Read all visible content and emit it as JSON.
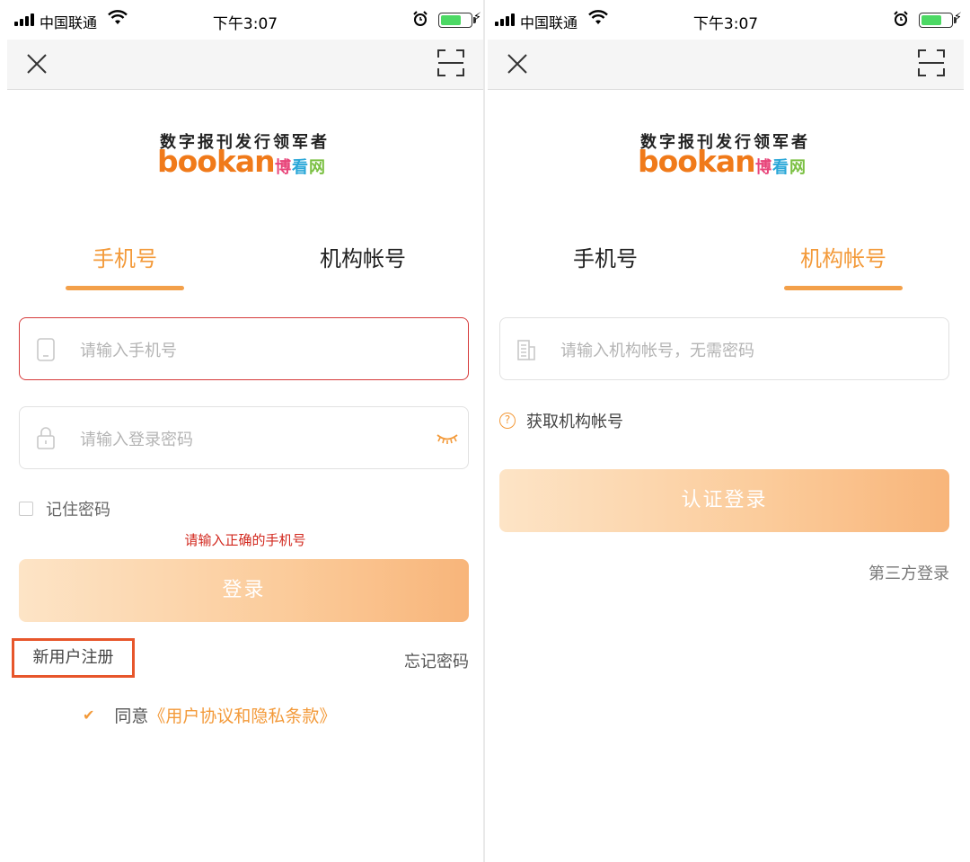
{
  "status_bar": {
    "carrier": "中国联通",
    "time": "下午3:07"
  },
  "logo": {
    "slogan": "数字报刊发行领军者",
    "brand": "bookan",
    "brand_cn": [
      "博",
      "看",
      "网"
    ]
  },
  "colors": {
    "accent": "#f39a3a",
    "error": "#d2281e",
    "highlight_box": "#e7562b"
  },
  "left_screen": {
    "tabs": [
      {
        "label": "手机号",
        "active": true
      },
      {
        "label": "机构帐号",
        "active": false
      }
    ],
    "phone_placeholder": "请输入手机号",
    "password_placeholder": "请输入登录密码",
    "remember_label": "记住密码",
    "error_message": "请输入正确的手机号",
    "login_button": "登录",
    "register_link": "新用户注册",
    "forgot_link": "忘记密码",
    "agree_prefix": "同意",
    "agree_link": "《用户协议和隐私条款》"
  },
  "right_screen": {
    "tabs": [
      {
        "label": "手机号",
        "active": false
      },
      {
        "label": "机构帐号",
        "active": true
      }
    ],
    "org_placeholder": "请输入机构帐号，无需密码",
    "help_link": "获取机构帐号",
    "login_button": "认证登录",
    "third_party_link": "第三方登录"
  }
}
